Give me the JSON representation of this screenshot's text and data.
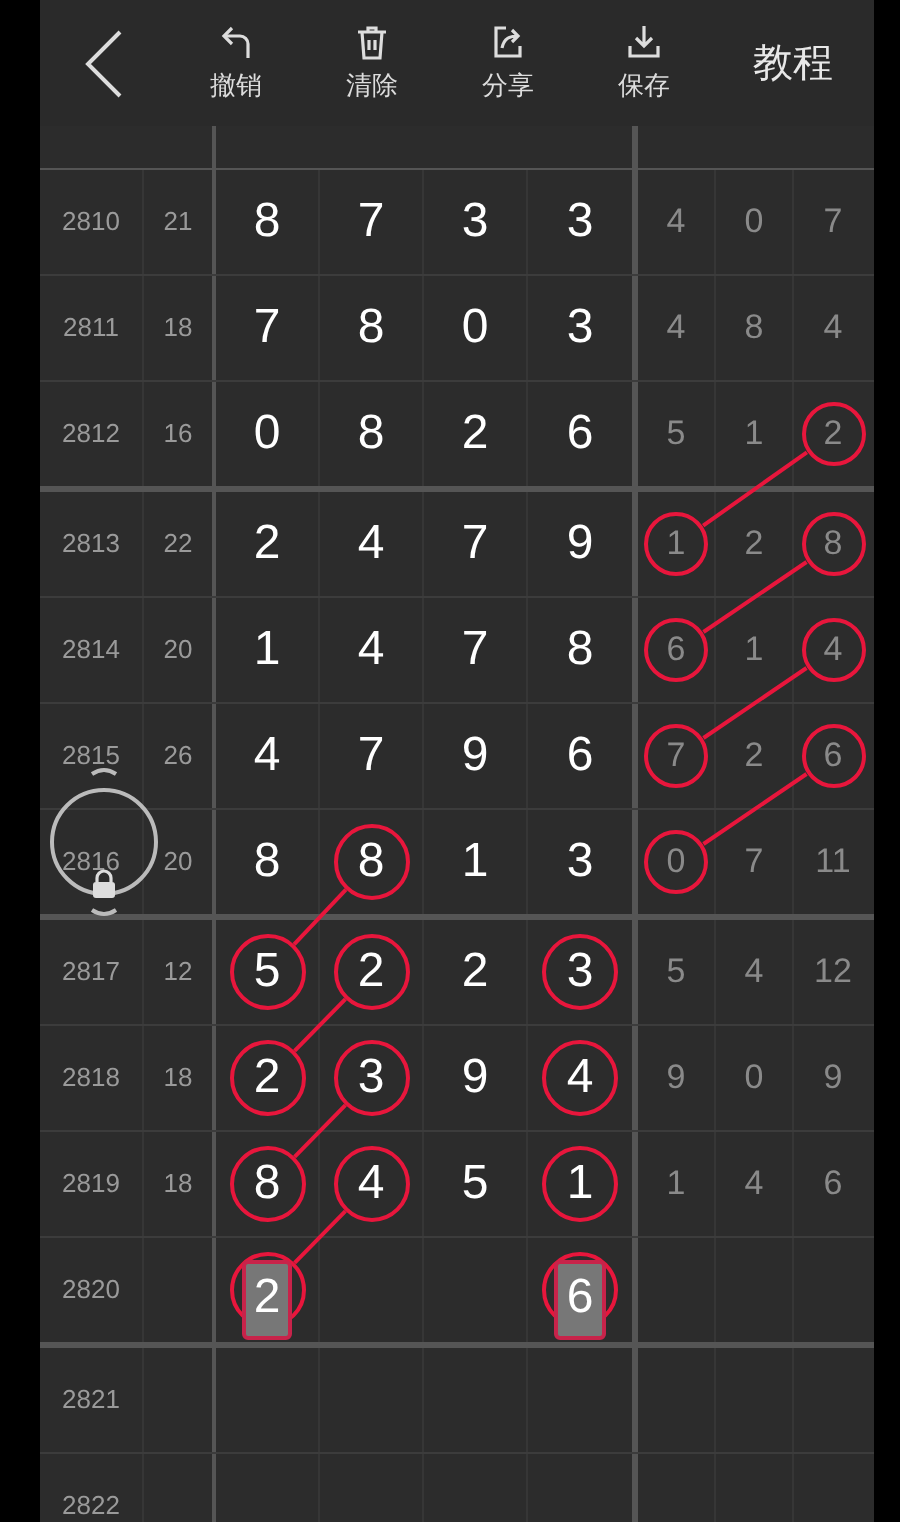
{
  "toolbar": {
    "tools": [
      {
        "label": "撤销",
        "kind": "undo"
      },
      {
        "label": "清除",
        "kind": "clear"
      },
      {
        "label": "分享",
        "kind": "share"
      },
      {
        "label": "保存",
        "kind": "save"
      }
    ],
    "tutorial": "教程"
  },
  "rows": [
    {
      "kind": "result",
      "period": "2810",
      "sum": "21",
      "group_end": false,
      "main": [
        {
          "digit": "8",
          "circled": false
        },
        {
          "digit": "7",
          "circled": false
        },
        {
          "digit": "3",
          "circled": false
        },
        {
          "digit": "3",
          "circled": false
        }
      ],
      "right": [
        {
          "digit": "4",
          "circled": false
        },
        {
          "digit": "0",
          "circled": false
        },
        {
          "digit": "7",
          "circled": false
        }
      ]
    },
    {
      "kind": "result",
      "period": "2811",
      "sum": "18",
      "group_end": false,
      "main": [
        {
          "digit": "7",
          "circled": false
        },
        {
          "digit": "8",
          "circled": false
        },
        {
          "digit": "0",
          "circled": false
        },
        {
          "digit": "3",
          "circled": false
        }
      ],
      "right": [
        {
          "digit": "4",
          "circled": false
        },
        {
          "digit": "8",
          "circled": false
        },
        {
          "digit": "4",
          "circled": false
        }
      ]
    },
    {
      "kind": "result",
      "period": "2812",
      "sum": "16",
      "group_end": true,
      "main": [
        {
          "digit": "0",
          "circled": false
        },
        {
          "digit": "8",
          "circled": false
        },
        {
          "digit": "2",
          "circled": false
        },
        {
          "digit": "6",
          "circled": false
        }
      ],
      "right": [
        {
          "digit": "5",
          "circled": false
        },
        {
          "digit": "1",
          "circled": false
        },
        {
          "digit": "2",
          "circled": true,
          "linked": true
        }
      ]
    },
    {
      "kind": "result",
      "period": "2813",
      "sum": "22",
      "group_end": false,
      "main": [
        {
          "digit": "2",
          "circled": false
        },
        {
          "digit": "4",
          "circled": false
        },
        {
          "digit": "7",
          "circled": false
        },
        {
          "digit": "9",
          "circled": false
        }
      ],
      "right": [
        {
          "digit": "1",
          "circled": true,
          "linked": false
        },
        {
          "digit": "2",
          "circled": false
        },
        {
          "digit": "8",
          "circled": true,
          "linked": true
        }
      ]
    },
    {
      "kind": "result",
      "period": "2814",
      "sum": "20",
      "group_end": false,
      "main": [
        {
          "digit": "1",
          "circled": false
        },
        {
          "digit": "4",
          "circled": false
        },
        {
          "digit": "7",
          "circled": false
        },
        {
          "digit": "8",
          "circled": false
        }
      ],
      "right": [
        {
          "digit": "6",
          "circled": true,
          "linked": false
        },
        {
          "digit": "1",
          "circled": false
        },
        {
          "digit": "4",
          "circled": true,
          "linked": true
        }
      ]
    },
    {
      "kind": "result",
      "period": "2815",
      "sum": "26",
      "group_end": false,
      "main": [
        {
          "digit": "4",
          "circled": false
        },
        {
          "digit": "7",
          "circled": false
        },
        {
          "digit": "9",
          "circled": false
        },
        {
          "digit": "6",
          "circled": false
        }
      ],
      "right": [
        {
          "digit": "7",
          "circled": true,
          "linked": false
        },
        {
          "digit": "2",
          "circled": false
        },
        {
          "digit": "6",
          "circled": true,
          "linked": true
        }
      ]
    },
    {
      "kind": "result",
      "period": "2816",
      "sum": "20",
      "group_end": true,
      "main": [
        {
          "digit": "8",
          "circled": false
        },
        {
          "digit": "8",
          "circled": true,
          "linked": true
        },
        {
          "digit": "1",
          "circled": false
        },
        {
          "digit": "3",
          "circled": false
        }
      ],
      "right": [
        {
          "digit": "0",
          "circled": true,
          "linked": false
        },
        {
          "digit": "7",
          "circled": false
        },
        {
          "digit": "11",
          "circled": false
        }
      ]
    },
    {
      "kind": "result",
      "period": "2817",
      "sum": "12",
      "group_end": false,
      "main": [
        {
          "digit": "5",
          "circled": true,
          "linked": false
        },
        {
          "digit": "2",
          "circled": true,
          "linked": true
        },
        {
          "digit": "2",
          "circled": false
        },
        {
          "digit": "3",
          "circled": true,
          "linked": false
        }
      ],
      "right": [
        {
          "digit": "5",
          "circled": false
        },
        {
          "digit": "4",
          "circled": false
        },
        {
          "digit": "12",
          "circled": false
        }
      ]
    },
    {
      "kind": "result",
      "period": "2818",
      "sum": "18",
      "group_end": false,
      "main": [
        {
          "digit": "2",
          "circled": true,
          "linked": false
        },
        {
          "digit": "3",
          "circled": true,
          "linked": true
        },
        {
          "digit": "9",
          "circled": false
        },
        {
          "digit": "4",
          "circled": true,
          "linked": false
        }
      ],
      "right": [
        {
          "digit": "9",
          "circled": false
        },
        {
          "digit": "0",
          "circled": false
        },
        {
          "digit": "9",
          "circled": false
        }
      ]
    },
    {
      "kind": "result",
      "period": "2819",
      "sum": "18",
      "group_end": false,
      "main": [
        {
          "digit": "8",
          "circled": true,
          "linked": false
        },
        {
          "digit": "4",
          "circled": true,
          "linked": true
        },
        {
          "digit": "5",
          "circled": false
        },
        {
          "digit": "1",
          "circled": true,
          "linked": false
        }
      ],
      "right": [
        {
          "digit": "1",
          "circled": false
        },
        {
          "digit": "4",
          "circled": false
        },
        {
          "digit": "6",
          "circled": false
        }
      ]
    },
    {
      "kind": "prediction",
      "period": "2820",
      "group_end": true,
      "main": [
        {
          "kind": "predicted",
          "digit": "2",
          "circled": true,
          "linked": false
        },
        {
          "kind": "blank"
        },
        {
          "kind": "blank"
        },
        {
          "kind": "predicted",
          "digit": "6",
          "circled": true,
          "linked": false
        }
      ]
    },
    {
      "kind": "blank",
      "period": "2821",
      "group_end": false
    },
    {
      "kind": "blank",
      "period": "2822",
      "group_end": false
    }
  ]
}
